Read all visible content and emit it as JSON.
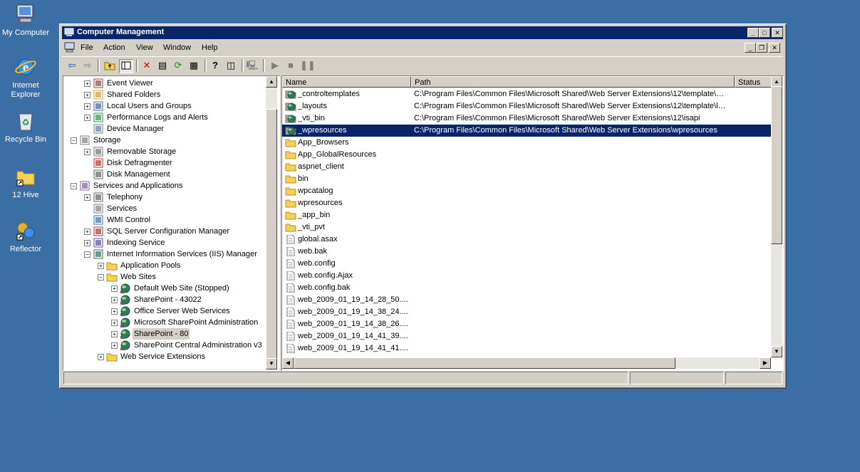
{
  "desktop": {
    "icons": [
      {
        "label": "My Computer"
      },
      {
        "label": "Internet Explorer"
      },
      {
        "label": "Recycle Bin"
      },
      {
        "label": "12 Hive"
      },
      {
        "label": "Reflector"
      }
    ]
  },
  "window": {
    "title": "Computer Management",
    "menu": [
      "File",
      "Action",
      "View",
      "Window",
      "Help"
    ]
  },
  "tree": {
    "items": [
      {
        "label": "Event Viewer",
        "expander": "+",
        "icon": "event-viewer"
      },
      {
        "label": "Shared Folders",
        "expander": "+",
        "icon": "shared-folders"
      },
      {
        "label": "Local Users and Groups",
        "expander": "+",
        "icon": "users"
      },
      {
        "label": "Performance Logs and Alerts",
        "expander": "+",
        "icon": "performance"
      },
      {
        "label": "Device Manager",
        "expander": "",
        "icon": "device-manager"
      },
      {
        "label": "Storage",
        "expander": "-",
        "icon": "storage"
      },
      {
        "label": "Removable Storage",
        "expander": "+",
        "icon": "removable-storage"
      },
      {
        "label": "Disk Defragmenter",
        "expander": "",
        "icon": "defrag"
      },
      {
        "label": "Disk Management",
        "expander": "",
        "icon": "disk"
      },
      {
        "label": "Services and Applications",
        "expander": "-",
        "icon": "services-apps"
      },
      {
        "label": "Telephony",
        "expander": "+",
        "icon": "telephony"
      },
      {
        "label": "Services",
        "expander": "",
        "icon": "services"
      },
      {
        "label": "WMI Control",
        "expander": "",
        "icon": "wmi"
      },
      {
        "label": "SQL Server Configuration Manager",
        "expander": "+",
        "icon": "sql"
      },
      {
        "label": "Indexing Service",
        "expander": "+",
        "icon": "indexing"
      },
      {
        "label": "Internet Information Services (IIS) Manager",
        "expander": "-",
        "icon": "iis"
      },
      {
        "label": "Application Pools",
        "expander": "+",
        "icon": "folder"
      },
      {
        "label": "Web Sites",
        "expander": "-",
        "icon": "folder"
      },
      {
        "label": "Default Web Site (Stopped)",
        "expander": "+",
        "icon": "globe"
      },
      {
        "label": "SharePoint - 43022",
        "expander": "+",
        "icon": "globe"
      },
      {
        "label": "Office Server Web Services",
        "expander": "+",
        "icon": "globe"
      },
      {
        "label": "Microsoft SharePoint Administration",
        "expander": "+",
        "icon": "globe"
      },
      {
        "label": "SharePoint - 80",
        "expander": "+",
        "icon": "globe",
        "selected": true
      },
      {
        "label": "SharePoint Central Administration v3",
        "expander": "+",
        "icon": "globe"
      },
      {
        "label": "Web Service Extensions",
        "expander": "+",
        "icon": "folder"
      }
    ]
  },
  "list": {
    "columns": [
      "Name",
      "Path",
      "Status"
    ],
    "rows": [
      {
        "name": "_controltemplates",
        "path": "C:\\Program Files\\Common Files\\Microsoft Shared\\Web Server Extensions\\12\\template\\co...",
        "icon": "globe"
      },
      {
        "name": "_layouts",
        "path": "C:\\Program Files\\Common Files\\Microsoft Shared\\Web Server Extensions\\12\\template\\lay...",
        "icon": "globe"
      },
      {
        "name": "_vti_bin",
        "path": "C:\\Program Files\\Common Files\\Microsoft Shared\\Web Server Extensions\\12\\isapi",
        "icon": "globe"
      },
      {
        "name": "_wpresources",
        "path": "C:\\Program Files\\Common Files\\Microsoft Shared\\Web Server Extensions\\wpresources",
        "icon": "globe",
        "selected": true
      },
      {
        "name": "App_Browsers",
        "path": "",
        "icon": "folder"
      },
      {
        "name": "App_GlobalResources",
        "path": "",
        "icon": "folder"
      },
      {
        "name": "aspnet_client",
        "path": "",
        "icon": "folder"
      },
      {
        "name": "bin",
        "path": "",
        "icon": "folder"
      },
      {
        "name": "wpcatalog",
        "path": "",
        "icon": "folder"
      },
      {
        "name": "wpresources",
        "path": "",
        "icon": "folder"
      },
      {
        "name": "_app_bin",
        "path": "",
        "icon": "folder"
      },
      {
        "name": "_vti_pvt",
        "path": "",
        "icon": "folder"
      },
      {
        "name": "global.asax",
        "path": "",
        "icon": "doc"
      },
      {
        "name": "web.bak",
        "path": "",
        "icon": "doc"
      },
      {
        "name": "web.config",
        "path": "",
        "icon": "doc"
      },
      {
        "name": "web.config.Ajax",
        "path": "",
        "icon": "doc"
      },
      {
        "name": "web.config.bak",
        "path": "",
        "icon": "doc"
      },
      {
        "name": "web_2009_01_19_14_28_50....",
        "path": "",
        "icon": "doc"
      },
      {
        "name": "web_2009_01_19_14_38_24....",
        "path": "",
        "icon": "doc"
      },
      {
        "name": "web_2009_01_19_14_38_26....",
        "path": "",
        "icon": "doc"
      },
      {
        "name": "web_2009_01_19_14_41_39....",
        "path": "",
        "icon": "doc"
      },
      {
        "name": "web_2009_01_19_14_41_41....",
        "path": "",
        "icon": "doc"
      }
    ]
  },
  "colors": {
    "desktop": "#3a6ea5",
    "titlebar": "#0a246a",
    "selection": "#0a246a",
    "chrome": "#d4d0c8"
  }
}
